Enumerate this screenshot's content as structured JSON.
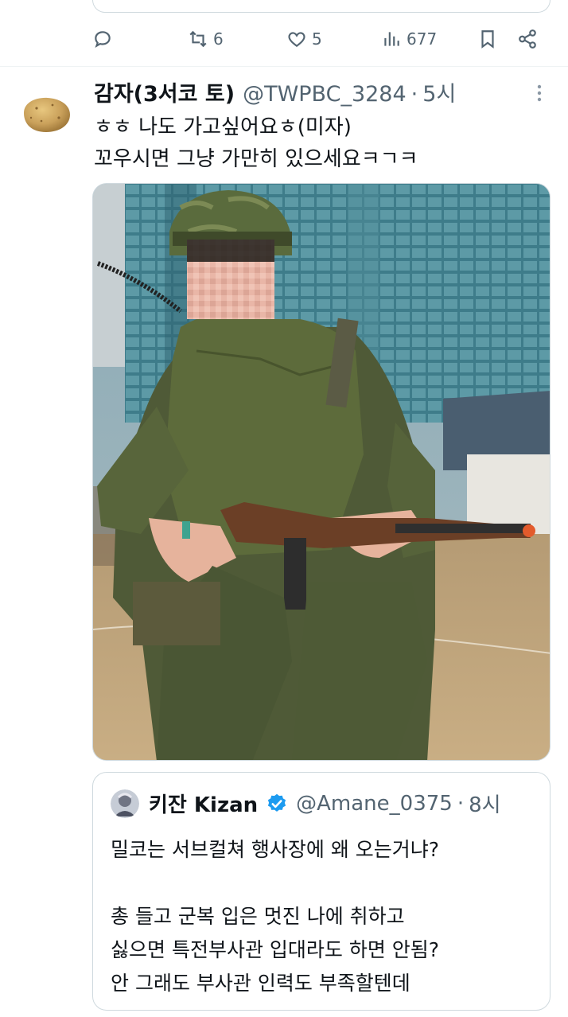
{
  "prev_tweet": {
    "actions": {
      "reply": {
        "icon": "reply-icon",
        "count": ""
      },
      "retweet": {
        "icon": "retweet-icon",
        "count": "6"
      },
      "like": {
        "icon": "heart-icon",
        "count": "5"
      },
      "views": {
        "icon": "views-icon",
        "count": "677"
      },
      "bookmark": {
        "icon": "bookmark-icon"
      },
      "share": {
        "icon": "share-icon"
      }
    }
  },
  "tweet": {
    "display_name": "감자(3서코 토)",
    "handle": "@TWPBC_3284",
    "separator": "·",
    "time": "5시",
    "text_lines": [
      "ㅎㅎ 나도 가고싶어요ㅎ(미자)",
      "꼬우시면 그냥 가만히 있으세요ㅋㄱㅋ"
    ],
    "avatar_icon": "potato-avatar",
    "more_icon": "more-vertical-icon"
  },
  "quoted_tweet": {
    "display_name": "키잔 Kizan",
    "handle": "@Amane_0375",
    "separator": "·",
    "time": "8시",
    "verified_icon": "verified-badge-icon",
    "text_lines": [
      "밀코는 서브컬쳐 행사장에 왜 오는거냐?",
      "",
      "총 들고 군복 입은 멋진 나에 취하고",
      "싫으면 특전부사관 입대라도 하면 안됨?",
      "안 그래도 부사관 인력도 부족할텐데"
    ]
  },
  "colors": {
    "text_primary": "#0f1419",
    "text_secondary": "#536471",
    "border": "#cfd9de",
    "verified": "#1d9bf0"
  }
}
